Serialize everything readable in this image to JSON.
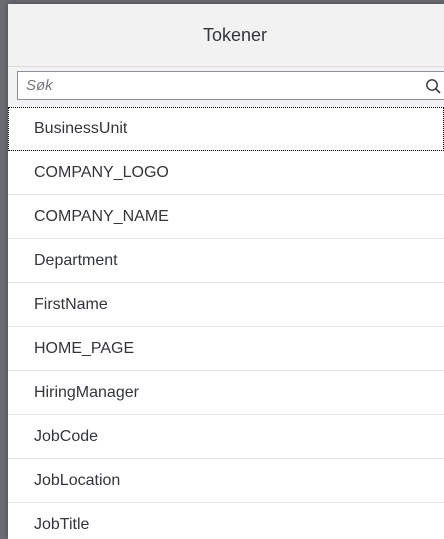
{
  "dialog": {
    "title": "Tokener"
  },
  "search": {
    "placeholder": "Søk",
    "icon": "search-icon"
  },
  "tokens": [
    "BusinessUnit",
    "COMPANY_LOGO",
    "COMPANY_NAME",
    "Department",
    "FirstName",
    "HOME_PAGE",
    "HiringManager",
    "JobCode",
    "JobLocation",
    "JobTitle"
  ],
  "colors": {
    "header_bg": "#f2f2f2",
    "text": "#32363a",
    "divider": "#e5e5e5"
  }
}
